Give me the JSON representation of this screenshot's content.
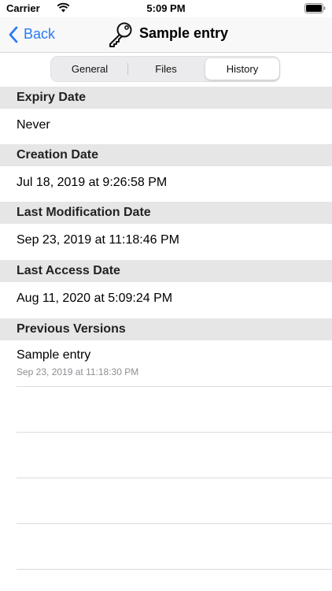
{
  "status_bar": {
    "carrier": "Carrier",
    "time": "5:09 PM"
  },
  "nav": {
    "back_label": "Back",
    "title": "Sample entry",
    "icon": "key-icon"
  },
  "segments": {
    "general": "General",
    "files": "Files",
    "history": "History",
    "selected": "History"
  },
  "sections": {
    "expiry": {
      "header": "Expiry Date",
      "value": "Never"
    },
    "creation": {
      "header": "Creation Date",
      "value": "Jul 18, 2019 at 9:26:58 PM"
    },
    "modification": {
      "header": "Last Modification Date",
      "value": "Sep 23, 2019 at 11:18:46 PM"
    },
    "access": {
      "header": "Last Access Date",
      "value": "Aug 11, 2020 at 5:09:24 PM"
    }
  },
  "previous_versions": {
    "header": "Previous Versions",
    "items": [
      {
        "title": "Sample entry",
        "date": "Sep 23, 2019 at 11:18:30 PM"
      }
    ]
  },
  "colors": {
    "accent": "#2a7af6",
    "section_bg": "#e6e6e6",
    "secondary_text": "#8e8e93"
  }
}
